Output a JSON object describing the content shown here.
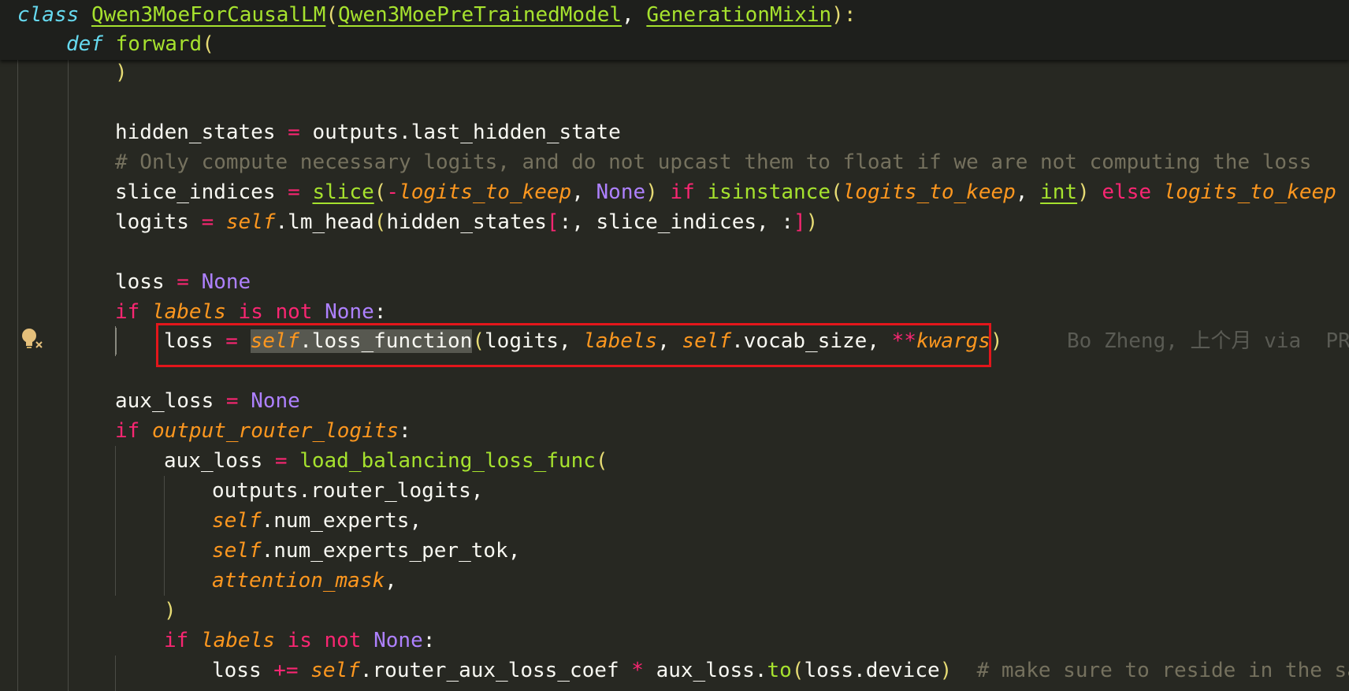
{
  "sticky": {
    "line1": {
      "kw": "class",
      "name": "Qwen3MoeForCausalLM",
      "open": "(",
      "base1": "Qwen3MoePreTrainedModel",
      "comma": ", ",
      "base2": "GenerationMixin",
      "close": "):"
    },
    "line2": {
      "kw": "def",
      "name": "forward",
      "open": "("
    }
  },
  "code": {
    "l_close": ")",
    "l_hidden": {
      "var": "hidden_states",
      "eq": " = ",
      "rhs": "outputs.last_hidden_state"
    },
    "l_comment": "# Only compute necessary logits, and do not upcast them to float if we are not computing the loss",
    "l_slice": {
      "var": "slice_indices",
      "eq": " = ",
      "fn": "slice",
      "p1": "(",
      "neg": "-",
      "arg": "logits_to_keep",
      "sep": ", ",
      "none": "None",
      "p2": ")",
      "if": " if ",
      "isinst": "isinstance",
      "p3": "(",
      "arg2": "logits_to_keep",
      "sep2": ", ",
      "int": "int",
      "p4": ")",
      "else": " else ",
      "arg3": "logits_to_keep"
    },
    "l_logits": {
      "var": "logits",
      "eq": " = ",
      "self": "self",
      "attr": ".lm_head",
      "p1": "(",
      "a": "hidden_states",
      "b1": "[",
      "b": ":, slice_indices, :",
      "b2": "]",
      "p2": ")"
    },
    "l_loss_none": {
      "var": "loss",
      "eq": " = ",
      "none": "None"
    },
    "l_if_labels": {
      "if": "if",
      "sp": " ",
      "labels": "labels",
      "isnot": " is not ",
      "none": "None",
      "colon": ":"
    },
    "l_loss_fn": {
      "var": "loss",
      "eq": " = ",
      "self": "self",
      "attr": ".loss_function",
      "p1": "(",
      "a": "logits",
      "sep": ", ",
      "labels": "labels",
      "sep2": ", ",
      "self2": "self",
      "attr2": ".vocab_size",
      "sep3": ", ",
      "star": "**",
      "kw": "kwargs",
      "p2": ")"
    },
    "blame": "Bo Zheng, 上个月 via  PR",
    "l_aux_none": {
      "var": "aux_loss",
      "eq": " = ",
      "none": "None"
    },
    "l_if_router": {
      "if": "if",
      "sp": " ",
      "arg": "output_router_logits",
      "colon": ":"
    },
    "l_aux_call": {
      "var": "aux_loss",
      "eq": " = ",
      "fn": "load_balancing_loss_func",
      "p1": "("
    },
    "l_arg1": "outputs.router_logits,",
    "l_arg2": {
      "self": "self",
      "rest": ".num_experts,"
    },
    "l_arg3": {
      "self": "self",
      "rest": ".num_experts_per_tok,"
    },
    "l_arg4": {
      "arg": "attention_mask",
      "comma": ","
    },
    "l_aux_close": ")",
    "l_if_labels2": {
      "if": "if",
      "sp": " ",
      "labels": "labels",
      "isnot": " is not ",
      "none": "None",
      "colon": ":"
    },
    "l_loss_add": {
      "var": "loss",
      "op": " += ",
      "self": "self",
      "attr": ".router_aux_loss_coef",
      "mul": " * ",
      "a": "aux_loss.",
      "fn": "to",
      "p1": "(",
      "b": "loss.device",
      "p2": ")",
      "cm": "  # make sure to reside in the same device"
    }
  }
}
